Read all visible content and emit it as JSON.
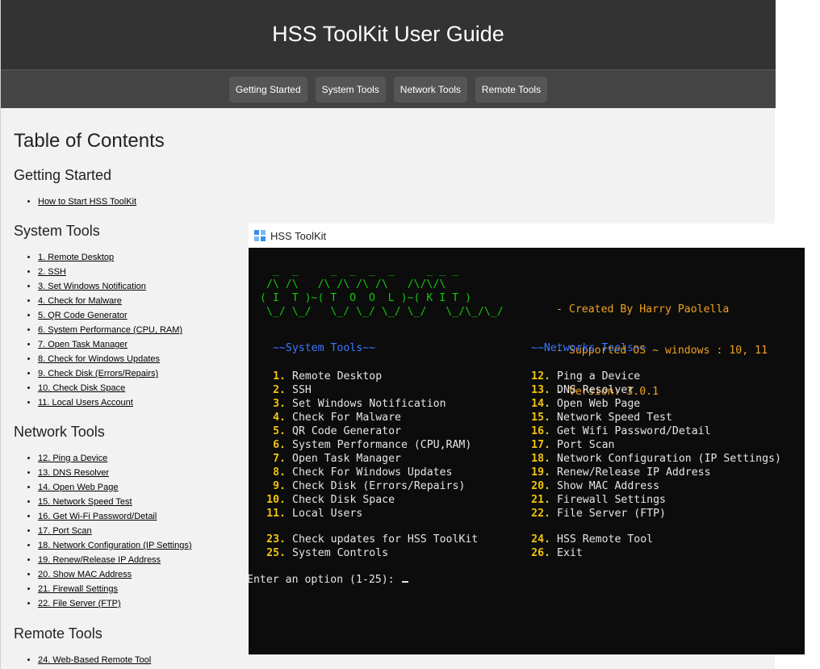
{
  "header": {
    "title": "HSS ToolKit User Guide"
  },
  "nav": [
    "Getting Started",
    "System Tools",
    "Network Tools",
    "Remote Tools"
  ],
  "toc": {
    "title": "Table of Contents",
    "sections": [
      {
        "heading": "Getting Started",
        "items": [
          "How to Start HSS ToolKit"
        ]
      },
      {
        "heading": "System Tools",
        "items": [
          "1. Remote Desktop",
          "2. SSH",
          "3. Set Windows Notification",
          "4. Check for Malware",
          "5. QR Code Generator",
          "6. System Performance (CPU, RAM)",
          "7. Open Task Manager",
          "8. Check for Windows Updates",
          "9. Check Disk (Errors/Repairs)",
          "10. Check Disk Space",
          "11. Local Users Account"
        ]
      },
      {
        "heading": "Network Tools",
        "items": [
          "12. Ping a Device",
          "13. DNS Resolver",
          "14. Open Web Page",
          "15. Network Speed Test",
          "16. Get Wi-Fi Password/Detail",
          "17. Port Scan",
          "18. Network Configuration (IP Settings)",
          "19. Renew/Release IP Address",
          "20. Show MAC Address",
          "21. Firewall Settings",
          "22. File Server (FTP)"
        ]
      },
      {
        "heading": "Remote Tools",
        "items": [
          "24. Web-Based Remote Tool"
        ]
      }
    ]
  },
  "window": {
    "title": "HSS ToolKit",
    "ascii_art": "  _  _     _  _  _  _     _ _ _\n /\\ /\\   /\\ /\\ /\\ /\\   /\\/\\/\\\n( I  T )~( T  O  O  L )~( K I T )\n \\_/ \\_/   \\_/ \\_/ \\_/ \\_/   \\_/\\_/\\_/",
    "info": [
      "- Created By Harry Paolella",
      "- Supported OS ~ windows : 10, 11",
      "- Version: 3.0.1"
    ],
    "system_heading": "~~System Tools~~",
    "network_heading": "~~Networks Tools~~",
    "system_tools": [
      {
        "num": "1.",
        "label": "Remote Desktop"
      },
      {
        "num": "2.",
        "label": "SSH"
      },
      {
        "num": "3.",
        "label": "Set Windows Notification"
      },
      {
        "num": "4.",
        "label": "Check For Malware"
      },
      {
        "num": "5.",
        "label": "QR Code Generator"
      },
      {
        "num": "6.",
        "label": "System Performance (CPU,RAM)"
      },
      {
        "num": "7.",
        "label": "Open Task Manager"
      },
      {
        "num": "8.",
        "label": "Check For Windows Updates"
      },
      {
        "num": "9.",
        "label": "Check Disk (Errors/Repairs)"
      },
      {
        "num": "10.",
        "label": "Check Disk Space"
      },
      {
        "num": "11.",
        "label": "Local Users"
      }
    ],
    "network_tools": [
      {
        "num": "12.",
        "label": "Ping a Device"
      },
      {
        "num": "13.",
        "label": "DNS Resolver"
      },
      {
        "num": "14.",
        "label": "Open Web Page"
      },
      {
        "num": "15.",
        "label": "Network Speed Test"
      },
      {
        "num": "16.",
        "label": "Get Wifi Password/Detail"
      },
      {
        "num": "17.",
        "label": "Port Scan"
      },
      {
        "num": "18.",
        "label": "Network Configuration (IP Settings)"
      },
      {
        "num": "19.",
        "label": "Renew/Release IP Address"
      },
      {
        "num": "20.",
        "label": "Show MAC Address"
      },
      {
        "num": "21.",
        "label": "Firewall Settings"
      },
      {
        "num": "22.",
        "label": "File Server (FTP)"
      }
    ],
    "extra_left": [
      {
        "num": "23.",
        "label": "Check updates for HSS ToolKit"
      },
      {
        "num": "25.",
        "label": "System Controls"
      }
    ],
    "extra_right": [
      {
        "num": "24.",
        "label": "HSS Remote Tool"
      },
      {
        "num": "26.",
        "label": "Exit"
      }
    ],
    "prompt": "Enter an option (1-25): "
  },
  "colors": {
    "header_bg": "#333333",
    "nav_bg": "#444444",
    "console_bg": "#0c0c0c",
    "ascii_green": "#16c60c",
    "info_orange": "#f0a020",
    "heading_blue": "#3b78ff",
    "number_yellow": "#f1c40f"
  }
}
